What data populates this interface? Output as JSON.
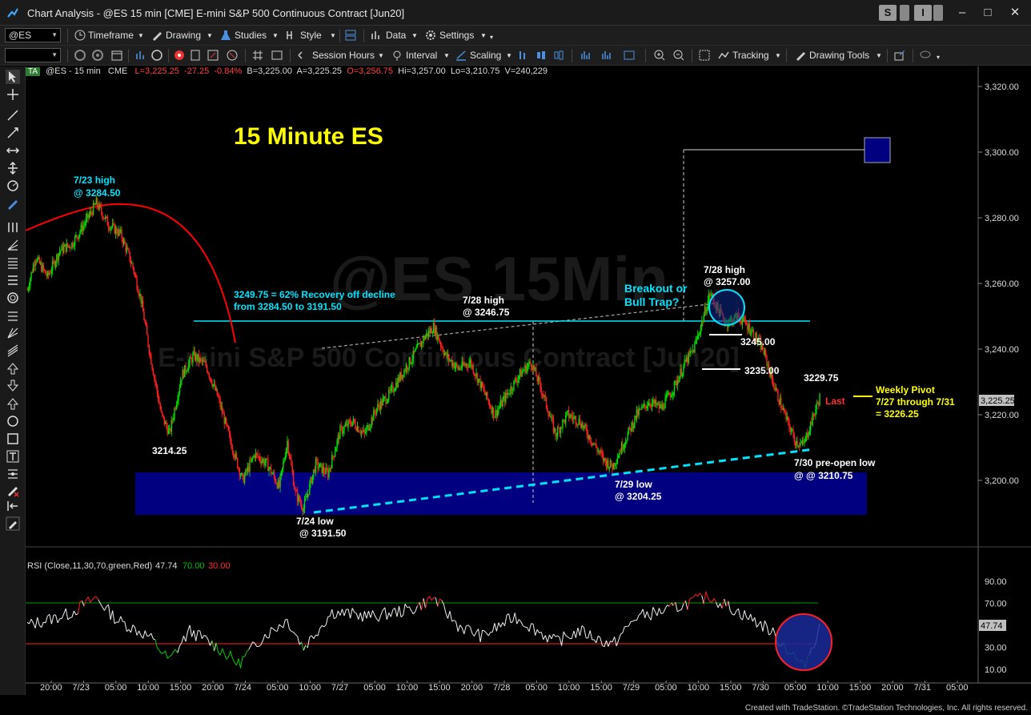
{
  "window": {
    "title": "Chart Analysis - @ES 15 min [CME] E-mini S&P 500 Continuous Contract [Jun20]",
    "btn_s": "S",
    "btn_i": "I",
    "minimize": "–",
    "maximize": "□",
    "close": "✕"
  },
  "toolbar1": {
    "symbol": "@ES",
    "timeframe": "Timeframe",
    "drawing": "Drawing",
    "studies": "Studies",
    "style": "Style",
    "data": "Data",
    "settings": "Settings"
  },
  "toolbar2": {
    "session_hours": "Session Hours",
    "interval": "Interval",
    "scaling": "Scaling",
    "tracking": "Tracking",
    "drawing_tools": "Drawing Tools"
  },
  "info": {
    "badge": "TA",
    "symbol": "@ES - 15 min",
    "exchange": "CME",
    "last": "L=3,225.25",
    "change": "-27.25",
    "pct": "-0.84%",
    "bid": "B=3,225.00",
    "ask": "A=3,225.25",
    "open": "O=3,256.75",
    "high": "Hi=3,257.00",
    "low": "Lo=3,210.75",
    "volume": "V=240,229"
  },
  "watermark": {
    "line1": "@ES 15Min",
    "line2": "E-mini S&P 500 Continuous Contract [Jun20]"
  },
  "annotations": {
    "title": "15 Minute ES",
    "high_723_a": "7/23 high",
    "high_723_b": "@ 3284.50",
    "recovery_a": "3249.75 = 62% Recovery off decline",
    "recovery_b": "from 3284.50 to 3191.50",
    "high_728a_a": "7/28 high",
    "high_728a_b": "@ 3246.75",
    "breakout_a": "Breakout or",
    "breakout_b": "Bull Trap?",
    "high_728b_a": "7/28 high",
    "high_728b_b": "@ 3257.00",
    "lvl_3245": "3245.00",
    "lvl_3235": "3235.00",
    "lvl_3229": "3229.75",
    "lvl_3214": "3214.25",
    "low_724_a": "7/24 low",
    "low_724_b": "@ 3191.50",
    "low_729_a": "7/29 low",
    "low_729_b": "@ 3204.25",
    "low_730_a": "7/30 pre-open low",
    "low_730_b": "@ @ 3210.75",
    "last_tag": "Last",
    "pivot_a": "Weekly Pivot",
    "pivot_b": "7/27 through 7/31",
    "pivot_c": "= 3226.25"
  },
  "price_axis": {
    "labels": [
      "3,320.00",
      "3,300.00",
      "3,280.00",
      "3,260.00",
      "3,240.00",
      "3,220.00",
      "3,200.00"
    ],
    "last_badge": "3,225.25"
  },
  "rsi": {
    "label": "RSI (Close,11,30,70,green,Red)",
    "value": "47.74",
    "ob": "70.00",
    "os": "30.00",
    "axis": [
      "90.00",
      "70.00",
      "30.00",
      "10.00"
    ],
    "badge": "47.74"
  },
  "time_axis": [
    "20:00",
    "7/23",
    "05:00",
    "10:00",
    "15:00",
    "20:00",
    "7/24",
    "05:00",
    "10:00",
    "7/27",
    "05:00",
    "10:00",
    "15:00",
    "20:00",
    "7/28",
    "05:00",
    "10:00",
    "15:00",
    "7/29",
    "05:00",
    "10:00",
    "15:00",
    "7/30",
    "05:00",
    "10:00",
    "15:00",
    "20:00",
    "7/31",
    "05:00"
  ],
  "footer": "Created with TradeStation. ©TradeStation Technologies, Inc. All rights reserved.",
  "colors": {
    "up": "#00e000",
    "down": "#ff2020",
    "cyan": "#00e5ff",
    "yellow": "#ffff00",
    "navy": "#000080",
    "red_arc": "#ff0000"
  },
  "chart_data": {
    "type": "candlestick",
    "title": "15 Minute ES",
    "ylim": [
      3186,
      3330
    ],
    "key_levels": [
      3284.5,
      3249.75,
      3246.75,
      3257.0,
      3245.0,
      3235.0,
      3229.75,
      3214.25,
      3191.5,
      3204.25,
      3210.75,
      3226.25
    ],
    "price_path": [
      [
        0,
        3258
      ],
      [
        2,
        3268
      ],
      [
        5,
        3262
      ],
      [
        8,
        3270
      ],
      [
        11,
        3272
      ],
      [
        14,
        3278
      ],
      [
        17,
        3284.5
      ],
      [
        20,
        3278
      ],
      [
        23,
        3275
      ],
      [
        26,
        3265
      ],
      [
        28,
        3255
      ],
      [
        30,
        3240
      ],
      [
        33,
        3220
      ],
      [
        35,
        3214.25
      ],
      [
        38,
        3232
      ],
      [
        41,
        3238
      ],
      [
        44,
        3235
      ],
      [
        47,
        3225
      ],
      [
        50,
        3212
      ],
      [
        53,
        3200
      ],
      [
        56,
        3208
      ],
      [
        59,
        3205
      ],
      [
        62,
        3198
      ],
      [
        64,
        3212
      ],
      [
        66,
        3196
      ],
      [
        68,
        3191.5
      ],
      [
        71,
        3205
      ],
      [
        74,
        3202
      ],
      [
        77,
        3215
      ],
      [
        80,
        3218
      ],
      [
        83,
        3214
      ],
      [
        86,
        3222
      ],
      [
        89,
        3226
      ],
      [
        92,
        3232
      ],
      [
        95,
        3238
      ],
      [
        98,
        3244
      ],
      [
        100,
        3246.75
      ],
      [
        103,
        3238
      ],
      [
        106,
        3234
      ],
      [
        109,
        3236
      ],
      [
        112,
        3228
      ],
      [
        115,
        3220
      ],
      [
        118,
        3226
      ],
      [
        121,
        3232
      ],
      [
        124,
        3236
      ],
      [
        127,
        3226
      ],
      [
        130,
        3214
      ],
      [
        133,
        3220
      ],
      [
        136,
        3218
      ],
      [
        139,
        3212
      ],
      [
        142,
        3206
      ],
      [
        144,
        3204.25
      ],
      [
        147,
        3212
      ],
      [
        150,
        3220
      ],
      [
        153,
        3224
      ],
      [
        156,
        3222
      ],
      [
        159,
        3228
      ],
      [
        162,
        3236
      ],
      [
        164,
        3240
      ],
      [
        166,
        3248
      ],
      [
        168,
        3257
      ],
      [
        170,
        3252
      ],
      [
        172,
        3248
      ],
      [
        175,
        3250
      ],
      [
        178,
        3246
      ],
      [
        181,
        3240
      ],
      [
        184,
        3228
      ],
      [
        187,
        3218
      ],
      [
        189,
        3212
      ],
      [
        191,
        3210.75
      ],
      [
        193,
        3218
      ],
      [
        195,
        3225.25
      ]
    ],
    "rsi": {
      "levels": [
        30,
        70
      ],
      "ylim": [
        0,
        100
      ],
      "path": [
        [
          0,
          50
        ],
        [
          10,
          60
        ],
        [
          17,
          75
        ],
        [
          22,
          55
        ],
        [
          30,
          40
        ],
        [
          35,
          18
        ],
        [
          40,
          45
        ],
        [
          47,
          30
        ],
        [
          52,
          15
        ],
        [
          58,
          40
        ],
        [
          64,
          55
        ],
        [
          68,
          30
        ],
        [
          75,
          62
        ],
        [
          85,
          58
        ],
        [
          95,
          65
        ],
        [
          100,
          75
        ],
        [
          106,
          50
        ],
        [
          112,
          40
        ],
        [
          120,
          58
        ],
        [
          130,
          35
        ],
        [
          136,
          45
        ],
        [
          144,
          32
        ],
        [
          150,
          58
        ],
        [
          158,
          64
        ],
        [
          164,
          72
        ],
        [
          168,
          76
        ],
        [
          175,
          62
        ],
        [
          182,
          48
        ],
        [
          188,
          25
        ],
        [
          191,
          12
        ],
        [
          195,
          47.74
        ]
      ]
    }
  }
}
